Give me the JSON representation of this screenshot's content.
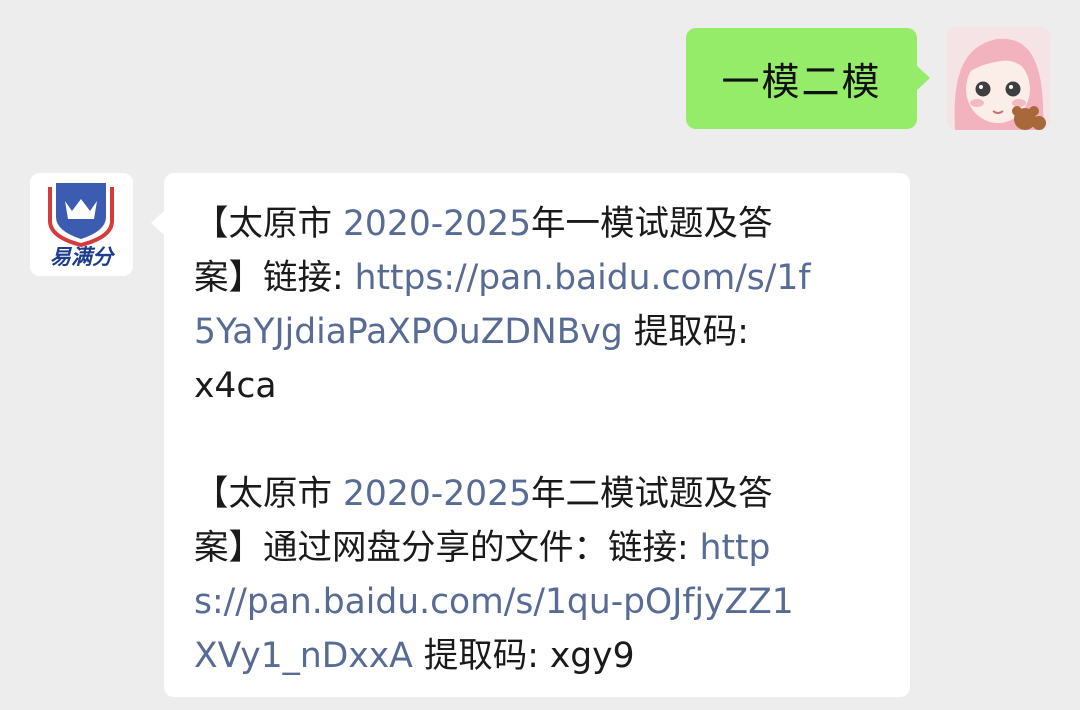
{
  "outgoing": {
    "text": "一模二模"
  },
  "incoming": {
    "logo_text": "易满分",
    "paragraph1": {
      "line1": {
        "prefix": "【太原市 ",
        "years": "2020-2025",
        "suffix": "年一模试题及答"
      },
      "line2": {
        "prefix": "案】链接: ",
        "link": "https://pan.baidu.com/s/1f"
      },
      "line3": {
        "link": "5YaYJjdiaPaXPOuZDNBvg",
        "suffix": " 提取码:"
      },
      "line4": {
        "text": "x4ca"
      }
    },
    "paragraph2": {
      "line1": {
        "prefix": "【太原市 ",
        "years": "2020-2025",
        "suffix": "年二模试题及答"
      },
      "line2": {
        "prefix": "案】通过网盘分享的文件：链接: ",
        "link": "http"
      },
      "line3": {
        "link": "s://pan.baidu.com/s/1qu-pOJfjyZZ1"
      },
      "line4": {
        "link": "XVy1_nDxxA",
        "suffix": " 提取码: xgy9"
      }
    }
  },
  "colors": {
    "background": "#ededed",
    "outgoing_bubble": "#95ec69",
    "incoming_bubble": "#ffffff",
    "link": "#576b95",
    "logo_shield": "#3b5cb0",
    "logo_red": "#d63a3a"
  }
}
